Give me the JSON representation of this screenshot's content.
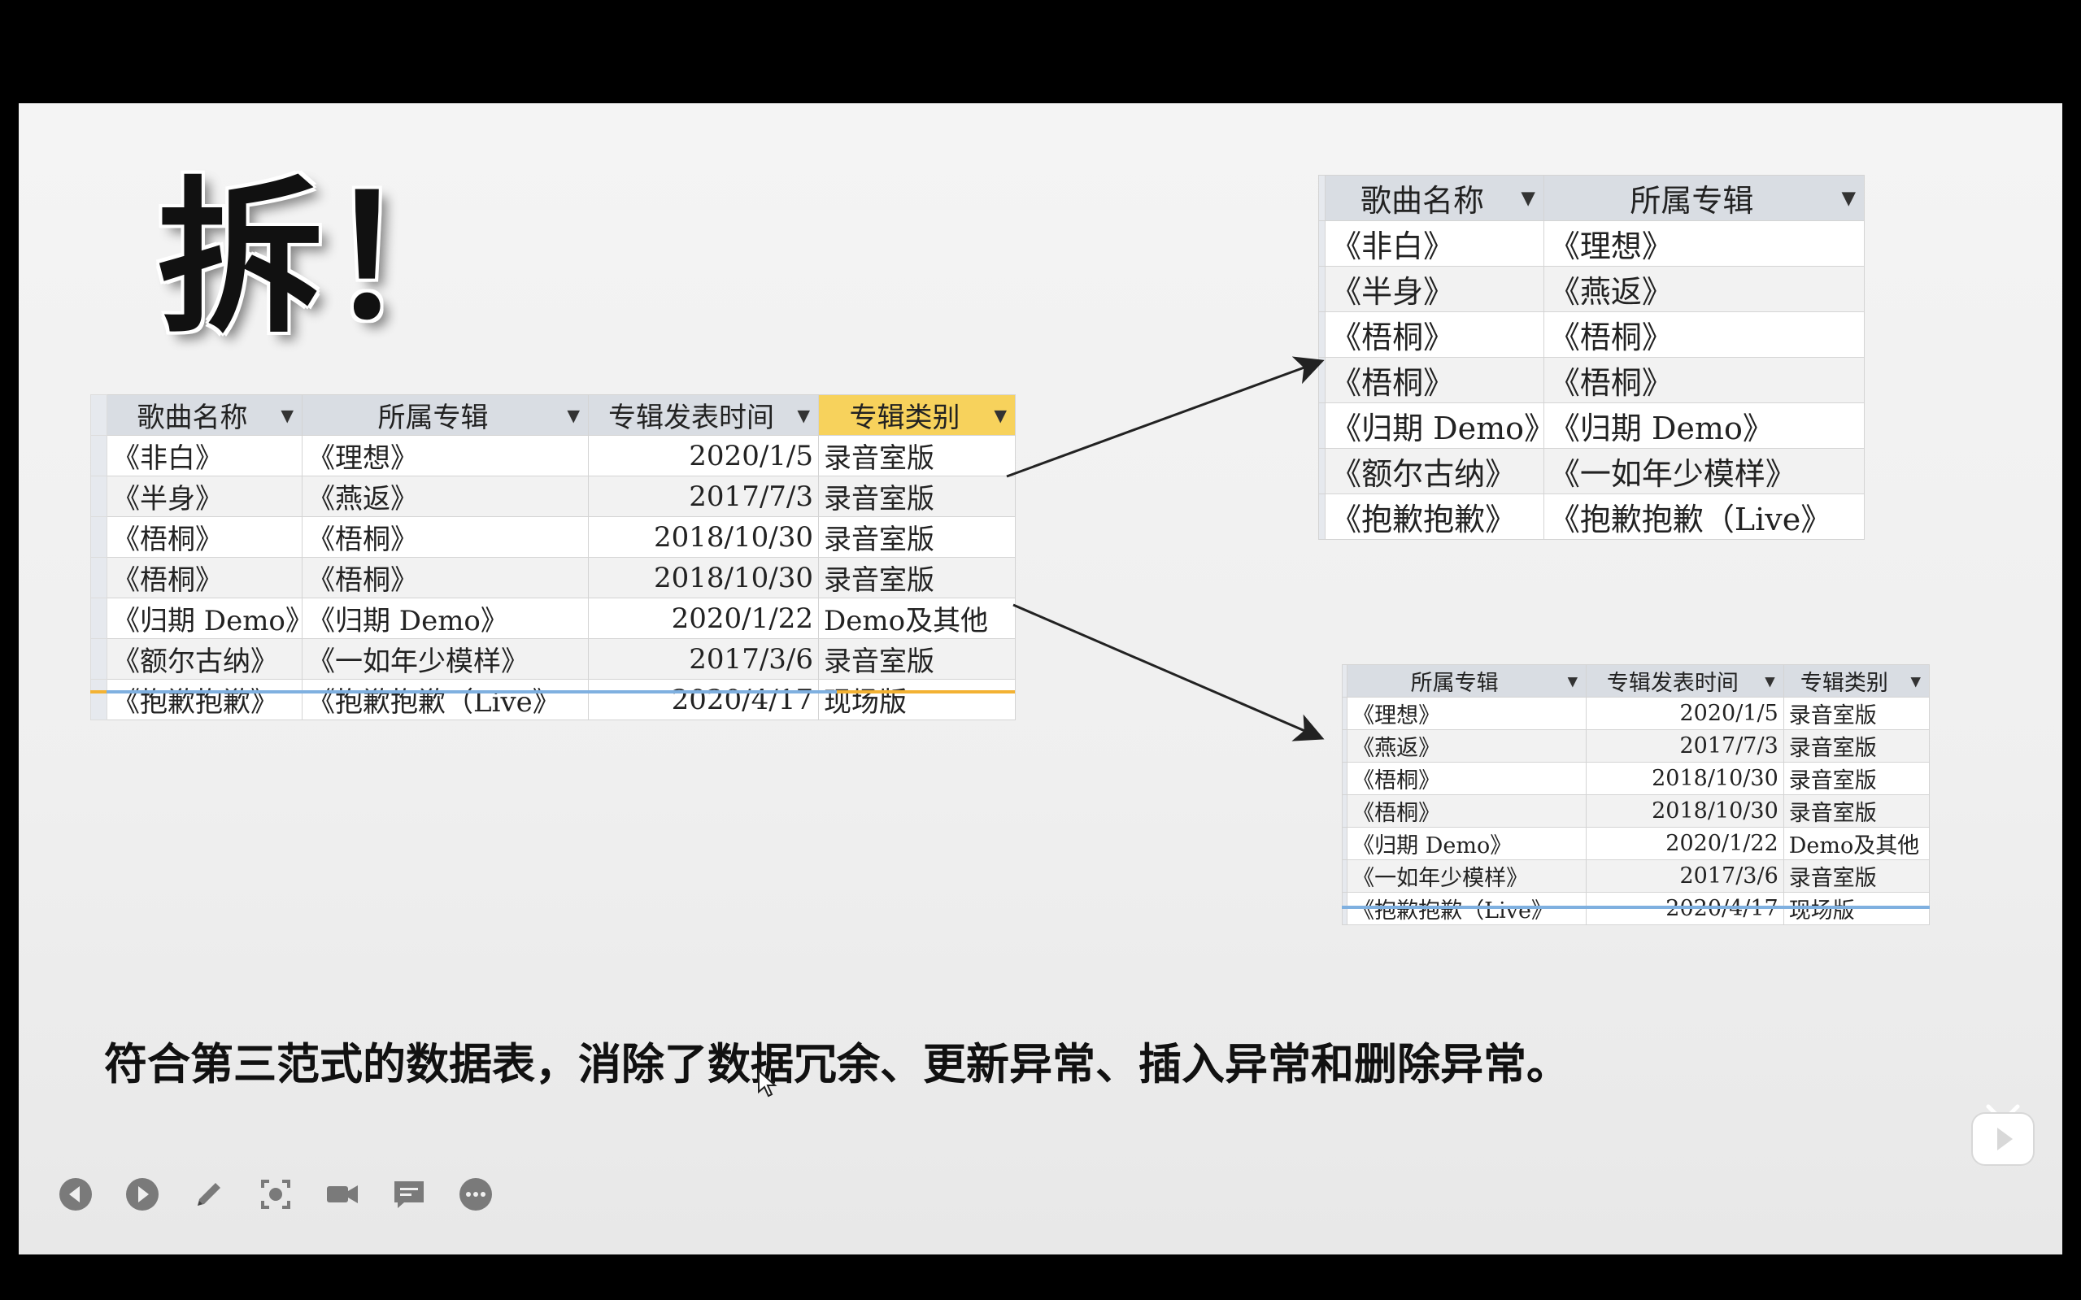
{
  "slide": {
    "title": "拆！",
    "caption": "符合第三范式的数据表，消除了数据冗余、更新异常、插入异常和删除异常。"
  },
  "main_table": {
    "columns": [
      "歌曲名称",
      "所属专辑",
      "专辑发表时间",
      "专辑类别"
    ],
    "rows": [
      [
        "《非白》",
        "《理想》",
        "2020/1/5",
        "录音室版"
      ],
      [
        "《半身》",
        "《燕返》",
        "2017/7/3",
        "录音室版"
      ],
      [
        "《梧桐》",
        "《梧桐》",
        "2018/10/30",
        "录音室版"
      ],
      [
        "《梧桐》",
        "《梧桐》",
        "2018/10/30",
        "录音室版"
      ],
      [
        "《归期 Demo》",
        "《归期 Demo》",
        "2020/1/22",
        "Demo及其他"
      ],
      [
        "《额尔古纳》",
        "《一如年少模样》",
        "2017/3/6",
        "录音室版"
      ],
      [
        "《抱歉抱歉》",
        "《抱歉抱歉（Live》",
        "2020/4/17",
        "现场版"
      ]
    ]
  },
  "song_table": {
    "columns": [
      "歌曲名称",
      "所属专辑"
    ],
    "rows": [
      [
        "《非白》",
        "《理想》"
      ],
      [
        "《半身》",
        "《燕返》"
      ],
      [
        "《梧桐》",
        "《梧桐》"
      ],
      [
        "《梧桐》",
        "《梧桐》"
      ],
      [
        "《归期 Demo》",
        "《归期 Demo》"
      ],
      [
        "《额尔古纳》",
        "《一如年少模样》"
      ],
      [
        "《抱歉抱歉》",
        "《抱歉抱歉（Live》"
      ]
    ]
  },
  "album_table": {
    "columns": [
      "所属专辑",
      "专辑发表时间",
      "专辑类别"
    ],
    "rows": [
      [
        "《理想》",
        "2020/1/5",
        "录音室版"
      ],
      [
        "《燕返》",
        "2017/7/3",
        "录音室版"
      ],
      [
        "《梧桐》",
        "2018/10/30",
        "录音室版"
      ],
      [
        "《梧桐》",
        "2018/10/30",
        "录音室版"
      ],
      [
        "《归期 Demo》",
        "2020/1/22",
        "Demo及其他"
      ],
      [
        "《一如年少模样》",
        "2017/3/6",
        "录音室版"
      ],
      [
        "《抱歉抱歉（Live》",
        "2020/4/17",
        "现场版"
      ]
    ]
  },
  "toolbar": [
    "prev-icon",
    "next-icon",
    "pen-icon",
    "screenshot-icon",
    "camera-icon",
    "comment-icon",
    "more-icon"
  ],
  "colors": {
    "header_bg": "#d9dde3",
    "selected_header": "#f7d25c",
    "slide_bg": "#f0f0f0",
    "frame": "#000000"
  }
}
